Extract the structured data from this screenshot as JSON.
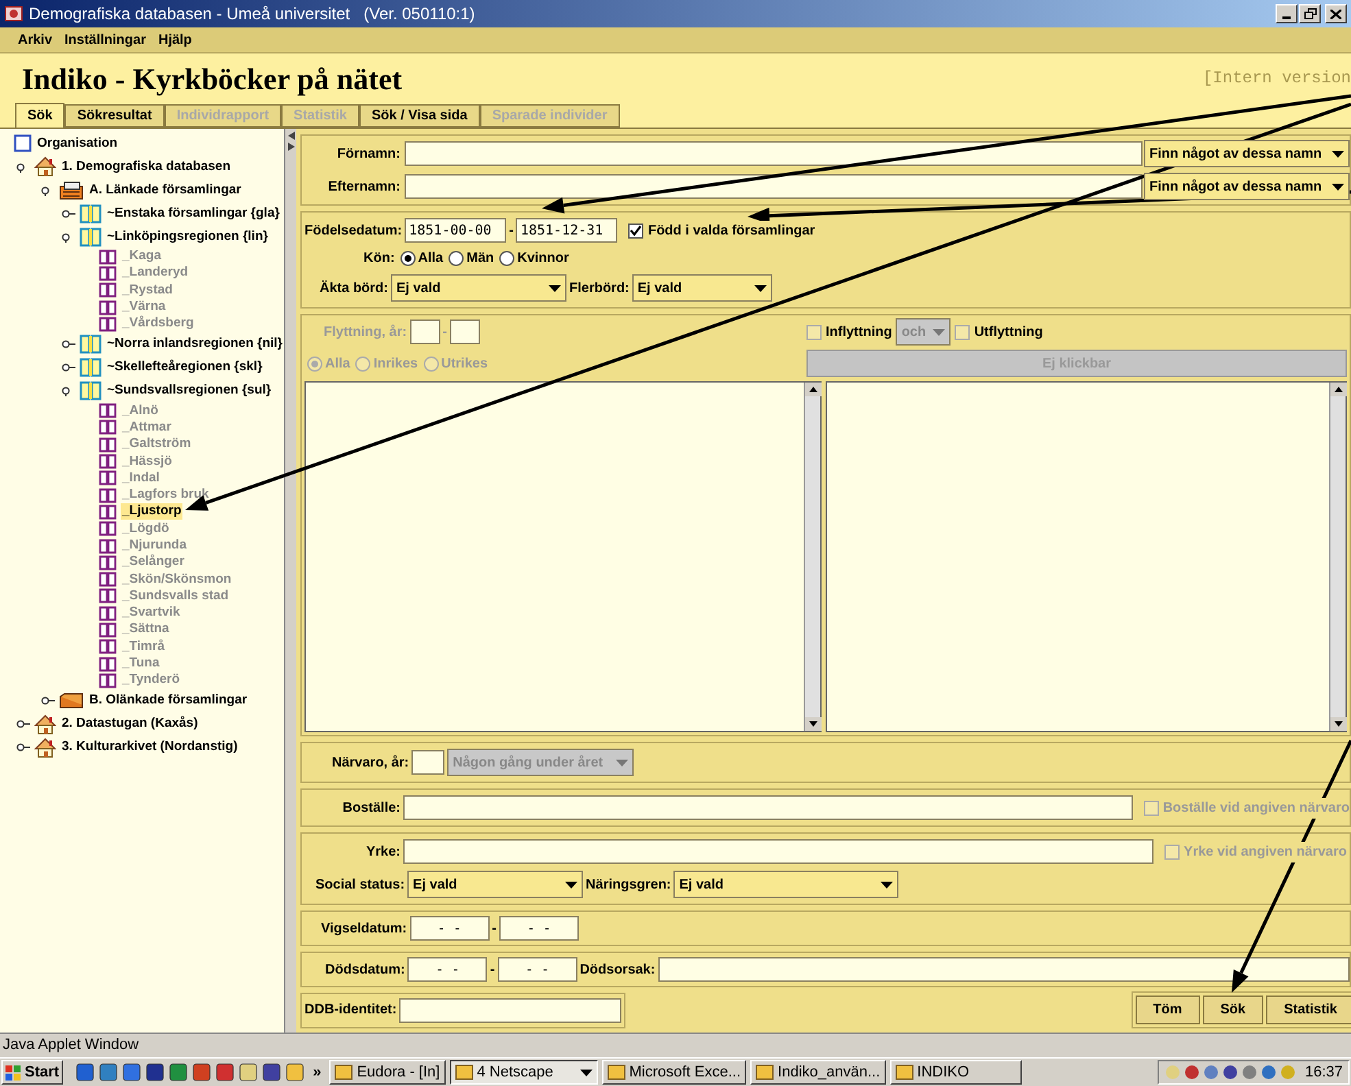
{
  "window": {
    "title": "Demografiska databasen - Umeå universitet   (Ver. 050110:1)"
  },
  "menu": [
    "Arkiv",
    "Inställningar",
    "Hjälp"
  ],
  "header": {
    "title": "Indiko - Kyrkböcker på nätet",
    "note": "[Intern version"
  },
  "tabs": [
    {
      "label": "Sök",
      "selected": true,
      "disabled": false
    },
    {
      "label": "Sökresultat",
      "selected": false,
      "disabled": false
    },
    {
      "label": "Individrapport",
      "selected": false,
      "disabled": true
    },
    {
      "label": "Statistik",
      "selected": false,
      "disabled": true
    },
    {
      "label": "Sök / Visa sida",
      "selected": false,
      "disabled": false
    },
    {
      "label": "Sparade individer",
      "selected": false,
      "disabled": true
    }
  ],
  "tree": [
    {
      "label": "Organisation",
      "kind": "org",
      "children": [
        {
          "label": "1. Demografiska databasen",
          "kind": "archive",
          "expanded": true,
          "children": [
            {
              "label": "A. Länkade församlingar",
              "kind": "cabinet",
              "expanded": true,
              "children": [
                {
                  "label": "~Enstaka församlingar {gla}",
                  "kind": "region",
                  "expanded": false
                },
                {
                  "label": "~Linköpingsregionen {lin}",
                  "kind": "region",
                  "expanded": true,
                  "children": [
                    {
                      "label": "_Kaga",
                      "kind": "parish",
                      "selected": false
                    },
                    {
                      "label": "_Landeryd",
                      "kind": "parish",
                      "selected": false
                    },
                    {
                      "label": "_Rystad",
                      "kind": "parish",
                      "selected": false
                    },
                    {
                      "label": "_Värna",
                      "kind": "parish",
                      "selected": false
                    },
                    {
                      "label": "_Vårdsberg",
                      "kind": "parish",
                      "selected": false
                    }
                  ]
                },
                {
                  "label": "~Norra inlandsregionen {nil}",
                  "kind": "region",
                  "expanded": false
                },
                {
                  "label": "~Skellefteåregionen {skl}",
                  "kind": "region",
                  "expanded": false
                },
                {
                  "label": "~Sundsvallsregionen {sul}",
                  "kind": "region",
                  "expanded": true,
                  "children": [
                    {
                      "label": "_Alnö",
                      "kind": "parish",
                      "selected": false
                    },
                    {
                      "label": "_Attmar",
                      "kind": "parish",
                      "selected": false
                    },
                    {
                      "label": "_Galtström",
                      "kind": "parish",
                      "selected": false
                    },
                    {
                      "label": "_Hässjö",
                      "kind": "parish",
                      "selected": false
                    },
                    {
                      "label": "_Indal",
                      "kind": "parish",
                      "selected": false
                    },
                    {
                      "label": "_Lagfors bruk",
                      "kind": "parish",
                      "selected": false
                    },
                    {
                      "label": "_Ljustorp",
                      "kind": "parish",
                      "selected": true
                    },
                    {
                      "label": "_Lögdö",
                      "kind": "parish",
                      "selected": false
                    },
                    {
                      "label": "_Njurunda",
                      "kind": "parish",
                      "selected": false
                    },
                    {
                      "label": "_Selånger",
                      "kind": "parish",
                      "selected": false
                    },
                    {
                      "label": "_Skön/Skönsmon",
                      "kind": "parish",
                      "selected": false
                    },
                    {
                      "label": "_Sundsvalls stad",
                      "kind": "parish",
                      "selected": false
                    },
                    {
                      "label": "_Svartvik",
                      "kind": "parish",
                      "selected": false
                    },
                    {
                      "label": "_Sättna",
                      "kind": "parish",
                      "selected": false
                    },
                    {
                      "label": "_Timrå",
                      "kind": "parish",
                      "selected": false
                    },
                    {
                      "label": "_Tuna",
                      "kind": "parish",
                      "selected": false
                    },
                    {
                      "label": "_Tynderö",
                      "kind": "parish",
                      "selected": false
                    }
                  ]
                }
              ]
            },
            {
              "label": "B. Olänkade församlingar",
              "kind": "drawer",
              "expanded": false
            }
          ]
        },
        {
          "label": "2. Datastugan (Kaxås)",
          "kind": "archive",
          "expanded": false
        },
        {
          "label": "3. Kulturarkivet (Nordanstig)",
          "kind": "archive",
          "expanded": false
        }
      ]
    }
  ],
  "names": [
    {
      "label": "Förnamn:",
      "mode": "Finn något av dessa namn"
    },
    {
      "label": "Efternamn:",
      "mode": "Finn något av dessa namn"
    }
  ],
  "birth": {
    "label": "Födelsedatum:",
    "from": "1851-00-00",
    "sep": "-",
    "to": "1851-12-31",
    "in_parishes": {
      "label": "Född i valda församlingar",
      "checked": true
    }
  },
  "gender": {
    "label": "Kön:",
    "options": [
      {
        "label": "Alla",
        "selected": true
      },
      {
        "label": "Män",
        "selected": false
      },
      {
        "label": "Kvinnor",
        "selected": false
      }
    ]
  },
  "legitimacy": {
    "label": "Äkta börd:",
    "value": "Ej vald"
  },
  "multiple_birth": {
    "label": "Flerbörd:",
    "value": "Ej vald"
  },
  "migration": {
    "disabled": true,
    "label": "Flyttning, år:",
    "sep": "-",
    "options": [
      {
        "label": "Alla",
        "selected": true
      },
      {
        "label": "Inrikes",
        "selected": false
      },
      {
        "label": "Utrikes",
        "selected": false
      }
    ],
    "in": {
      "label": "Inflyttning",
      "checked": false
    },
    "conjunction": "och",
    "out": {
      "label": "Utflyttning",
      "checked": false
    },
    "button": "Ej klickbar"
  },
  "presence": {
    "label": "Närvaro, år:",
    "mode": "Någon gång under året",
    "disabled": true
  },
  "residence": {
    "label": "Boställe:",
    "check": {
      "label": "Boställe vid angiven närvaro",
      "checked": false,
      "disabled": true
    }
  },
  "occupation": {
    "label": "Yrke:",
    "check": {
      "label": "Yrke vid angiven närvaro",
      "checked": false,
      "disabled": true
    },
    "social": {
      "label": "Social status:",
      "value": "Ej vald"
    },
    "industry": {
      "label": "Näringsgren:",
      "value": "Ej vald"
    }
  },
  "marriage": {
    "label": "Vigseldatum:",
    "from": "-   -",
    "sep": "-",
    "to": "-   -"
  },
  "death": {
    "label": "Dödsdatum:",
    "from": "-   -",
    "sep": "-",
    "to": "-   -",
    "cause": "Dödsorsak:"
  },
  "ddb": {
    "label": "DDB-identitet:"
  },
  "buttons": [
    "Töm",
    "Sök",
    "Statistik"
  ],
  "status_bar": "Java Applet Window",
  "taskbar": {
    "start": "Start",
    "more": "»",
    "tasks": [
      {
        "label": "Eudora - [In]",
        "selected": false
      },
      {
        "label": "4 Netscape",
        "selected": true
      },
      {
        "label": "Microsoft Exce...",
        "selected": false
      },
      {
        "label": "Indiko_använ...",
        "selected": false
      },
      {
        "label": "INDIKO",
        "selected": false
      }
    ],
    "clock": "16:37"
  }
}
